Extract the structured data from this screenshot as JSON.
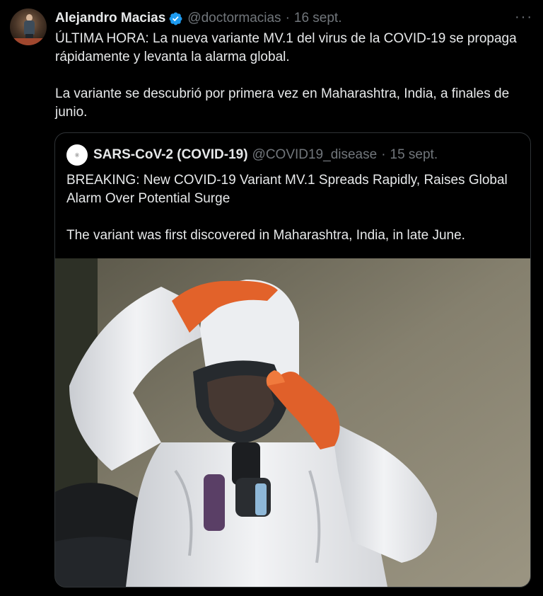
{
  "tweet": {
    "author_name": "Alejandro Macias",
    "author_handle": "@doctormacias",
    "separator": "·",
    "date": "16 sept.",
    "more_label": "···",
    "paragraphs": [
      "ÚLTIMA HORA: La nueva variante MV.1 del virus de la COVID-19 se propaga rápidamente y levanta la alarma global.",
      "La variante se descubrió por primera vez en Maharashtra, India, a finales de junio."
    ]
  },
  "quoted_tweet": {
    "author_name": "SARS-CoV-2 (COVID-19)",
    "author_handle": "@COVID19_disease",
    "separator": "·",
    "date": "15 sept.",
    "paragraphs": [
      "BREAKING: New COVID-19 Variant MV.1 Spreads Rapidly, Raises Global Alarm Over Potential Surge",
      "The variant was first discovered in Maharashtra, India, in late June."
    ]
  },
  "colors": {
    "background": "#000000",
    "text": "#e7e9ea",
    "secondary_text": "#71767b",
    "verified_badge": "#1d9bf0",
    "border": "#2f3336"
  },
  "icons": {
    "verified": "verified-badge-icon",
    "more": "more-options-icon"
  }
}
